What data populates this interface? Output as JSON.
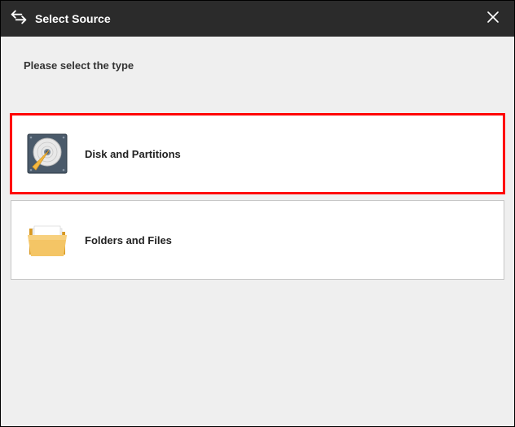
{
  "dialog": {
    "title": "Select Source",
    "prompt": "Please select the type"
  },
  "options": [
    {
      "label": "Disk and Partitions",
      "selected": true
    },
    {
      "label": "Folders and Files",
      "selected": false
    }
  ]
}
